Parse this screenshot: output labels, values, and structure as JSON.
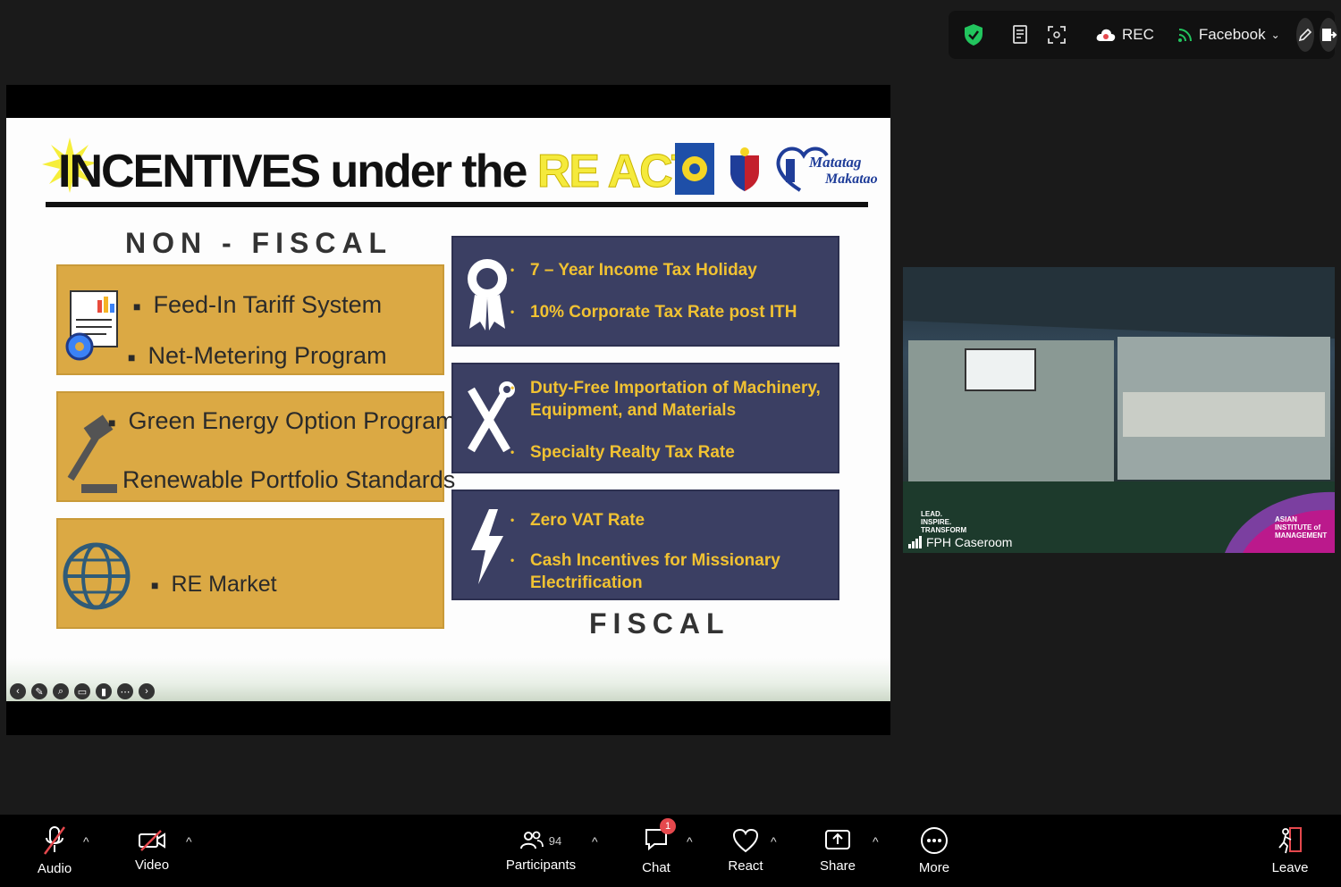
{
  "topbar": {
    "rec_label": "REC",
    "stream_label": "Facebook"
  },
  "slide": {
    "title_main": "INCENTIVES under the",
    "title_highlight": "RE ACT",
    "logo_text_1": "Matatag",
    "logo_text_2": "Makatao",
    "non_fiscal_label": "NON - FISCAL",
    "fiscal_label": "FISCAL",
    "non_fiscal": [
      {
        "items": [
          "Feed-In Tariff System",
          "Net-Metering Program"
        ]
      },
      {
        "items": [
          "Green Energy Option Program",
          "Renewable Portfolio Standards"
        ]
      },
      {
        "items": [
          "RE Market"
        ]
      }
    ],
    "fiscal": [
      {
        "items": [
          "7 – Year Income Tax Holiday",
          "10% Corporate Tax Rate post ITH"
        ]
      },
      {
        "items": [
          "Duty-Free Importation of Machinery, Equipment, and Materials",
          "Specialty Realty Tax Rate"
        ]
      },
      {
        "items": [
          "Zero VAT Rate",
          "Cash Incentives for Missionary Electrification"
        ]
      }
    ]
  },
  "video": {
    "participant_name": "FPH Caseroom",
    "watermark": "LEAD. INSPIRE. TRANSFORM",
    "brand": "ASIAN INSTITUTE of MANAGEMENT"
  },
  "toolbar": {
    "audio": "Audio",
    "video": "Video",
    "participants": "Participants",
    "participants_count": "94",
    "chat": "Chat",
    "chat_badge": "1",
    "react": "React",
    "share": "Share",
    "more": "More",
    "leave": "Leave"
  },
  "colors": {
    "non_fiscal_box": "#dba944",
    "fiscal_box": "#3b3f63",
    "fiscal_text": "#f1c232",
    "leave_icon": "#e5484d"
  }
}
